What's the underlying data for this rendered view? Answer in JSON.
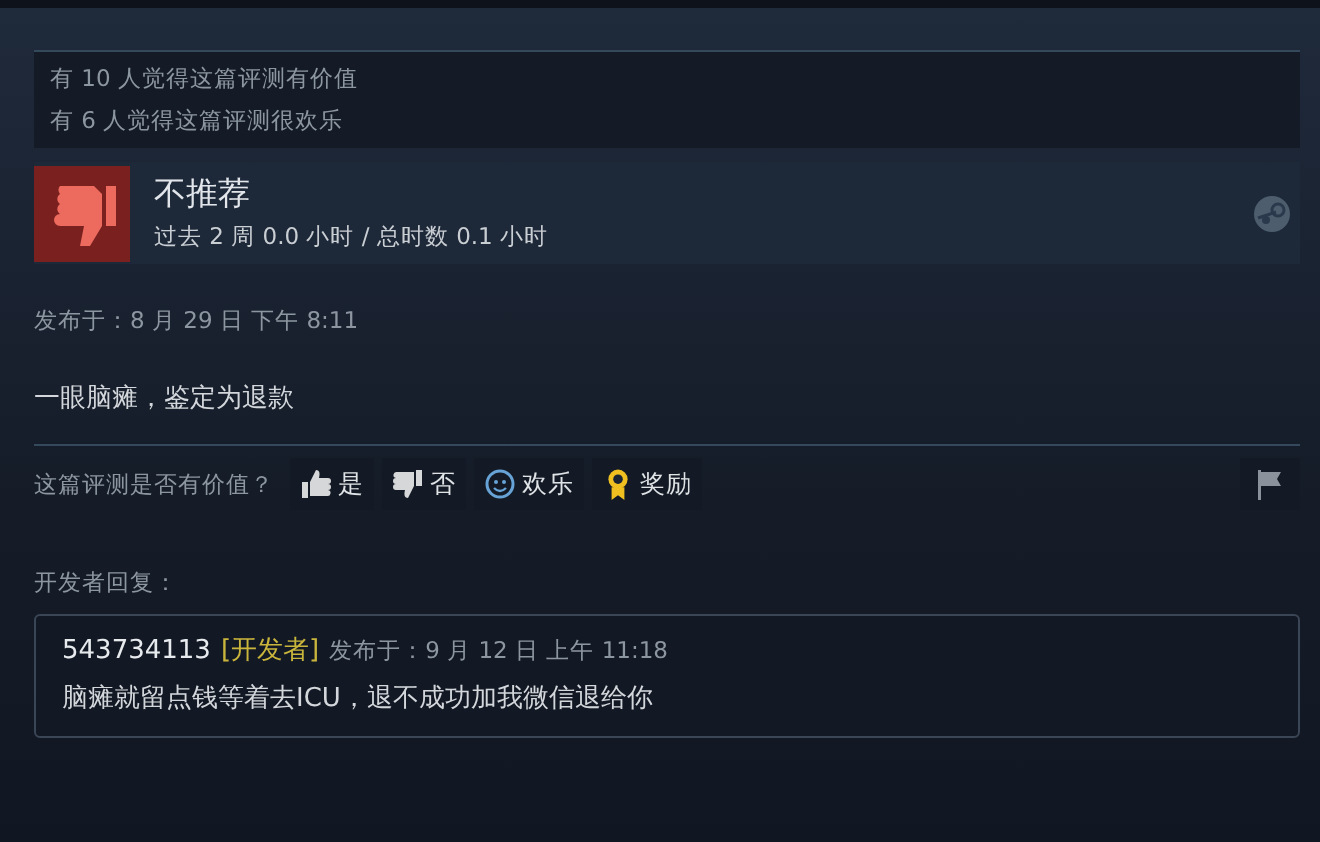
{
  "helpful_counts": [
    "有 10 人觉得这篇评测有价值",
    "有 6 人觉得这篇评测很欢乐"
  ],
  "recommendation": {
    "verdict": "不推荐",
    "playtime": "过去 2 周 0.0 小时 / 总时数 0.1 小时"
  },
  "posted": "发布于：8 月 29 日 下午 8:11",
  "review_text": "一眼脑瘫，鉴定为退款",
  "vote": {
    "prompt": "这篇评测是否有价值？",
    "buttons": [
      {
        "kind": "up",
        "label": "是"
      },
      {
        "kind": "down",
        "label": "否"
      },
      {
        "kind": "funny",
        "label": "欢乐"
      },
      {
        "kind": "award",
        "label": "奖励"
      }
    ]
  },
  "developer_reply": {
    "heading": "开发者回复：",
    "author": "543734113",
    "badge": "[开发者]",
    "posted": "发布于：9 月 12 日 上午 11:18",
    "text": "脑瘫就留点钱等着去ICU，退不成功加我微信退给你"
  }
}
